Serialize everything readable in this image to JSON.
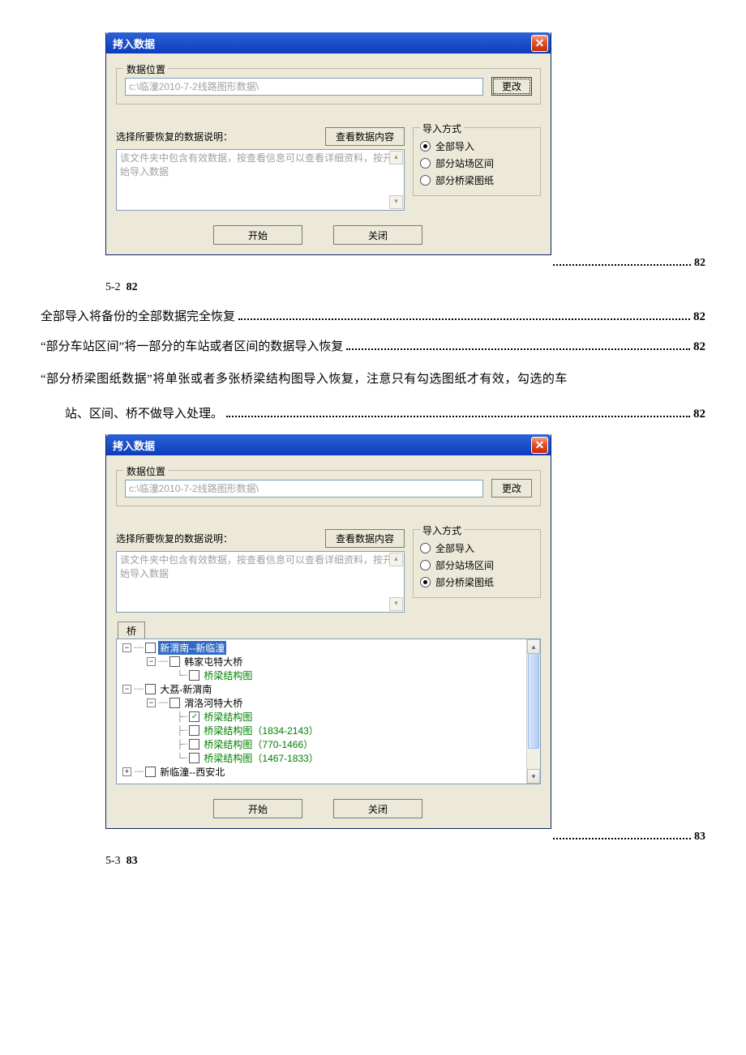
{
  "dialog1": {
    "title": "拷入数据",
    "group_location": "数据位置",
    "path": "c:\\临潼2010-7-2线路图形数据\\",
    "change_btn": "更改",
    "restore_label": "选择所要恢复的数据说明：",
    "view_btn": "查看数据内容",
    "desc_text": "该文件夹中包含有效数据，按查看信息可以查看详细资料，按开始导入数据",
    "import_legend": "导入方式",
    "radio_all": "全部导入",
    "radio_station": "部分站场区间",
    "radio_bridge": "部分桥梁图纸",
    "selected": "all",
    "start_btn": "开始",
    "close_btn": "关闭",
    "page_ref": "82"
  },
  "caption1": {
    "prefix": "5-2",
    "page": "82"
  },
  "toc": {
    "line1": {
      "text": "全部导入将备份的全部数据完全恢复",
      "page": "82"
    },
    "line2": {
      "text": "“部分车站区间”将一部分的车站或者区间的数据导入恢复",
      "page": "82"
    },
    "line3a": "“部分桥梁图纸数据”将单张或者多张桥梁结构图导入恢复，注意只有勾选图纸才有效，勾选的车",
    "line3b": {
      "text": "站、区间、桥不做导入处理。",
      "page": "82"
    }
  },
  "dialog2": {
    "title": "拷入数据",
    "group_location": "数据位置",
    "path": "c:\\临潼2010-7-2线路图形数据\\",
    "change_btn": "更改",
    "restore_label": "选择所要恢复的数据说明：",
    "view_btn": "查看数据内容",
    "desc_text": "该文件夹中包含有效数据，按查看信息可以查看详细资料，按开始导入数据",
    "import_legend": "导入方式",
    "radio_all": "全部导入",
    "radio_station": "部分站场区间",
    "radio_bridge": "部分桥梁图纸",
    "selected": "bridge",
    "tab_label": "桥",
    "tree": {
      "n1": "新渭南--新临潼",
      "n1_1": "韩家屯特大桥",
      "n1_1_1": "桥梁结构图",
      "n2": "大荔-新渭南",
      "n2_1": "渭洛河特大桥",
      "n2_1_1": "桥梁结构图",
      "n2_1_2": "桥梁结构图（1834-2143）",
      "n2_1_3": "桥梁结构图（770-1466）",
      "n2_1_4": "桥梁结构图（1467-1833）",
      "n3": "新临潼--西安北"
    },
    "start_btn": "开始",
    "close_btn": "关闭",
    "page_ref": "83"
  },
  "caption2": {
    "prefix": "5-3",
    "page": "83"
  }
}
